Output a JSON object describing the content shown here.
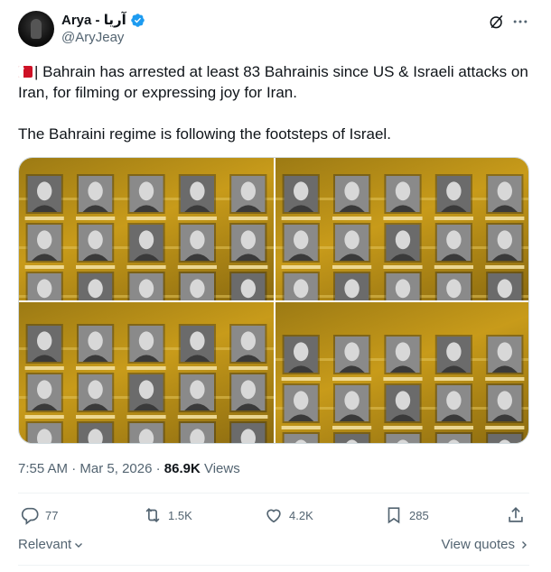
{
  "author": {
    "display_name": "Arya - آریا",
    "handle": "@AryJeay"
  },
  "tweet": {
    "line1": "| Bahrain has arrested at least 83 Bahrainis since US & Israeli attacks on Iran, for filming or expressing joy for Iran.",
    "line2": "The Bahraini regime is following the footsteps of Israel."
  },
  "meta": {
    "time": "7:55 AM",
    "separator1": "·",
    "date": "Mar 5, 2026",
    "separator2": "·",
    "views_count": "86.9K",
    "views_label": "Views"
  },
  "actions": {
    "replies": "77",
    "reposts": "1.5K",
    "likes": "4.2K",
    "bookmarks": "285"
  },
  "footer": {
    "sort_label": "Relevant",
    "view_quotes_label": "View quotes"
  },
  "colors": {
    "accent": "#1d9bf0",
    "secondary_text": "#536471",
    "primary_text": "#0f1419",
    "media_gold": "#c89b1a"
  },
  "icons": {
    "verified": "verified-badge-icon",
    "grok": "grok-icon",
    "more": "more-icon",
    "reply": "reply-icon",
    "repost": "repost-icon",
    "like": "heart-icon",
    "bookmark": "bookmark-icon",
    "share": "share-icon"
  }
}
